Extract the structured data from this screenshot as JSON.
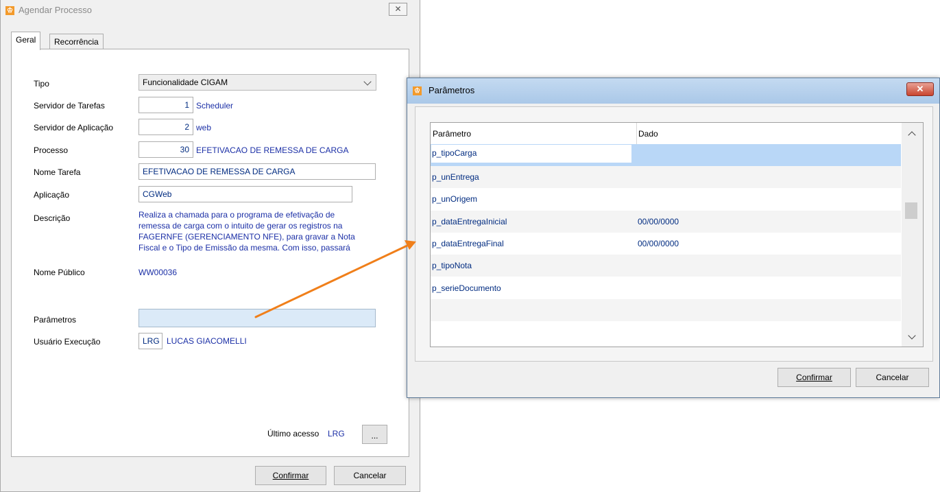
{
  "main_window": {
    "title": "Agendar Processo",
    "close_symbol": "✕",
    "tabs": [
      {
        "label": "Geral"
      },
      {
        "label": "Recorrência"
      }
    ],
    "form": {
      "tipo": {
        "label": "Tipo",
        "value": "Funcionalidade CIGAM"
      },
      "servidor_tarefas": {
        "label": "Servidor de Tarefas",
        "value": "1",
        "name": "Scheduler"
      },
      "servidor_aplicacao": {
        "label": "Servidor de Aplicação",
        "value": "2",
        "name": "web"
      },
      "processo": {
        "label": "Processo",
        "value": "30",
        "name": "EFETIVACAO DE REMESSA DE CARGA"
      },
      "nome_tarefa": {
        "label": "Nome Tarefa",
        "value": "EFETIVACAO DE REMESSA DE CARGA"
      },
      "aplicacao": {
        "label": "Aplicação",
        "value": "CGWeb"
      },
      "descricao": {
        "label": "Descrição",
        "lines": [
          "Realiza a chamada para o programa de efetivação de",
          "remessa de carga com o intuito de gerar os registros na",
          "FAGERNFE (GERENCIAMENTO NFE), para gravar a Nota",
          "Fiscal e o Tipo de Emissão da mesma. Com isso, passará"
        ]
      },
      "nome_publico": {
        "label": "Nome Público",
        "value": "WW00036"
      },
      "parametros": {
        "label": "Parâmetros",
        "value": ""
      },
      "usuario_execucao": {
        "label": "Usuário Execução",
        "code": "LRG",
        "name": "LUCAS GIACOMELLI"
      },
      "ultimo_acesso": {
        "label": "Último acesso",
        "value": "LRG"
      },
      "ellipsis_label": "..."
    },
    "buttons": {
      "confirm_label": "Confirmar",
      "cancel_label": "Cancelar"
    }
  },
  "params_window": {
    "title": "Parâmetros",
    "close_symbol": "✕",
    "columns": [
      "Parâmetro",
      "Dado"
    ],
    "rows": [
      {
        "param": "p_tipoCarga",
        "value": ""
      },
      {
        "param": "p_unEntrega",
        "value": ""
      },
      {
        "param": "p_unOrigem",
        "value": ""
      },
      {
        "param": "p_dataEntregaInicial",
        "value": "00/00/0000"
      },
      {
        "param": "p_dataEntregaFinal",
        "value": "00/00/0000"
      },
      {
        "param": "p_tipoNota",
        "value": ""
      },
      {
        "param": "p_serieDocumento",
        "value": ""
      }
    ],
    "buttons": {
      "confirm_label": "Confirmar",
      "cancel_label": "Cancelar"
    }
  },
  "colors": {
    "accent_arrow": "#f07f1a",
    "link_blue": "#1b2fa6",
    "selection": "#b9d7f7"
  }
}
